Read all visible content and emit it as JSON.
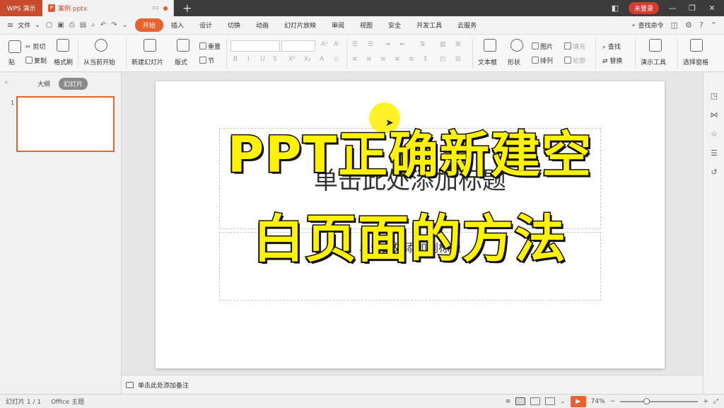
{
  "titlebar": {
    "app_name": "WPS 演示",
    "doc_name": "案例.pptx",
    "new_tab": "+",
    "login_label": "未登录",
    "icons": [
      "screen-icon",
      "dot-icon",
      "restore-icon",
      "minimize-icon",
      "maximize-icon",
      "close-icon"
    ]
  },
  "menu": {
    "hamburger": "≡",
    "file_label": "文件",
    "tabs": [
      "开始",
      "插入",
      "设计",
      "切换",
      "动画",
      "幻灯片放映",
      "审阅",
      "视图",
      "安全",
      "开发工具",
      "云服务"
    ],
    "active_tab": "开始",
    "search_label": "查找命令"
  },
  "ribbon": {
    "paste": "贴",
    "cut": "剪切",
    "copy": "复制",
    "format_painter": "格式刷",
    "from_current": "从当前开始",
    "new_slide": "新建幻灯片",
    "layout": "版式",
    "reset": "重置",
    "section": "节",
    "text_box": "文本框",
    "shapes": "形状",
    "picture": "图片",
    "arrange": "排列",
    "fill": "填充",
    "outline": "轮廓",
    "find": "查找",
    "replace": "替换",
    "presentation_tools": "演示工具",
    "select_pane": "选择窗格",
    "font_buttons": [
      "B",
      "I",
      "U",
      "S"
    ]
  },
  "left_panel": {
    "outline_tab": "大纲",
    "slides_tab": "幻灯片",
    "slide_number": "1"
  },
  "slide": {
    "title_placeholder": "单击此处添加标题",
    "subtitle_placeholder": "单击此处添加副标题",
    "overlay_line1": "PPT正确新建空",
    "overlay_line2": "白页面的方法"
  },
  "notes": {
    "placeholder": "单击此处添加备注"
  },
  "status": {
    "slide_count": "幻灯片 1 / 1",
    "theme": "Office 主题",
    "zoom": "74%",
    "zoom_level": 0.3,
    "minus": "−",
    "plus": "+"
  }
}
